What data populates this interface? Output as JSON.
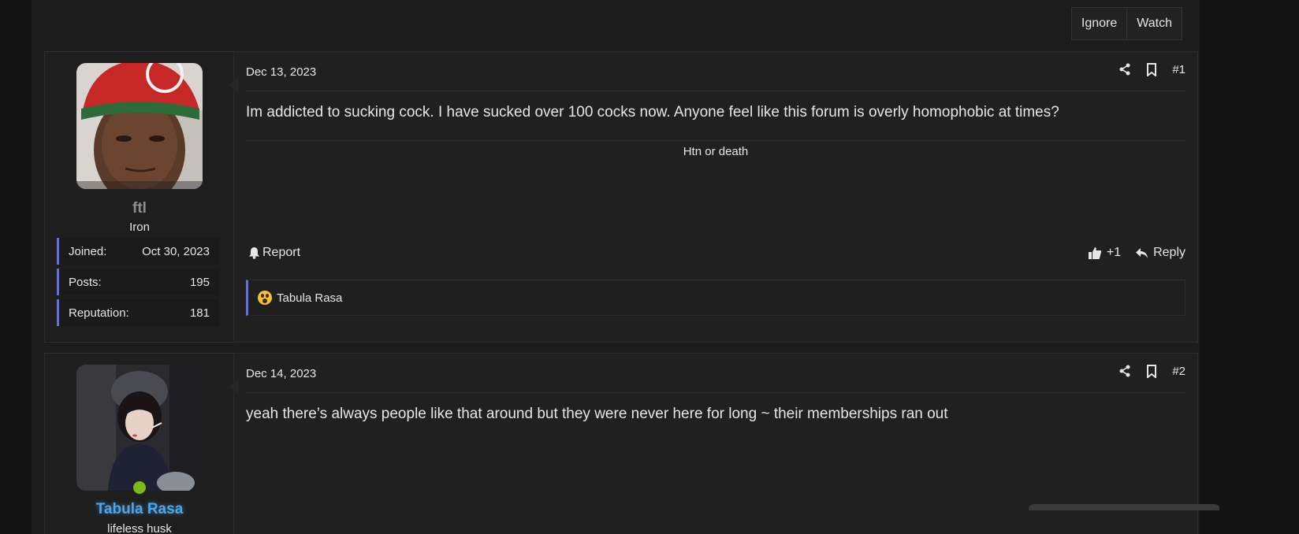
{
  "thread_actions": {
    "ignore": "Ignore",
    "watch": "Watch"
  },
  "posts": [
    {
      "date": "Dec 13, 2023",
      "number": "#1",
      "username": "ftl",
      "user_title": "Iron",
      "stats": {
        "joined_label": "Joined:",
        "joined_value": "Oct 30, 2023",
        "posts_label": "Posts:",
        "posts_value": "195",
        "rep_label": "Reputation:",
        "rep_value": "181"
      },
      "body": "Im addicted to sucking cock. I have sucked over 100 cocks now. Anyone feel like this forum is overly homophobic at times?",
      "signature": "Htn or death",
      "report_label": "Report",
      "like_count": "+1",
      "reply_label": "Reply",
      "reaction_user": "Tabula Rasa"
    },
    {
      "date": "Dec 14, 2023",
      "number": "#2",
      "username": "Tabula Rasa",
      "user_title": "lifeless husk",
      "body": "yeah there’s always people like that around but they were never here for long ~ their memberships ran out"
    }
  ],
  "colors": {
    "accent": "#6b6fc9",
    "username_blue": "#4ea6e6",
    "online": "#7cba1c"
  }
}
